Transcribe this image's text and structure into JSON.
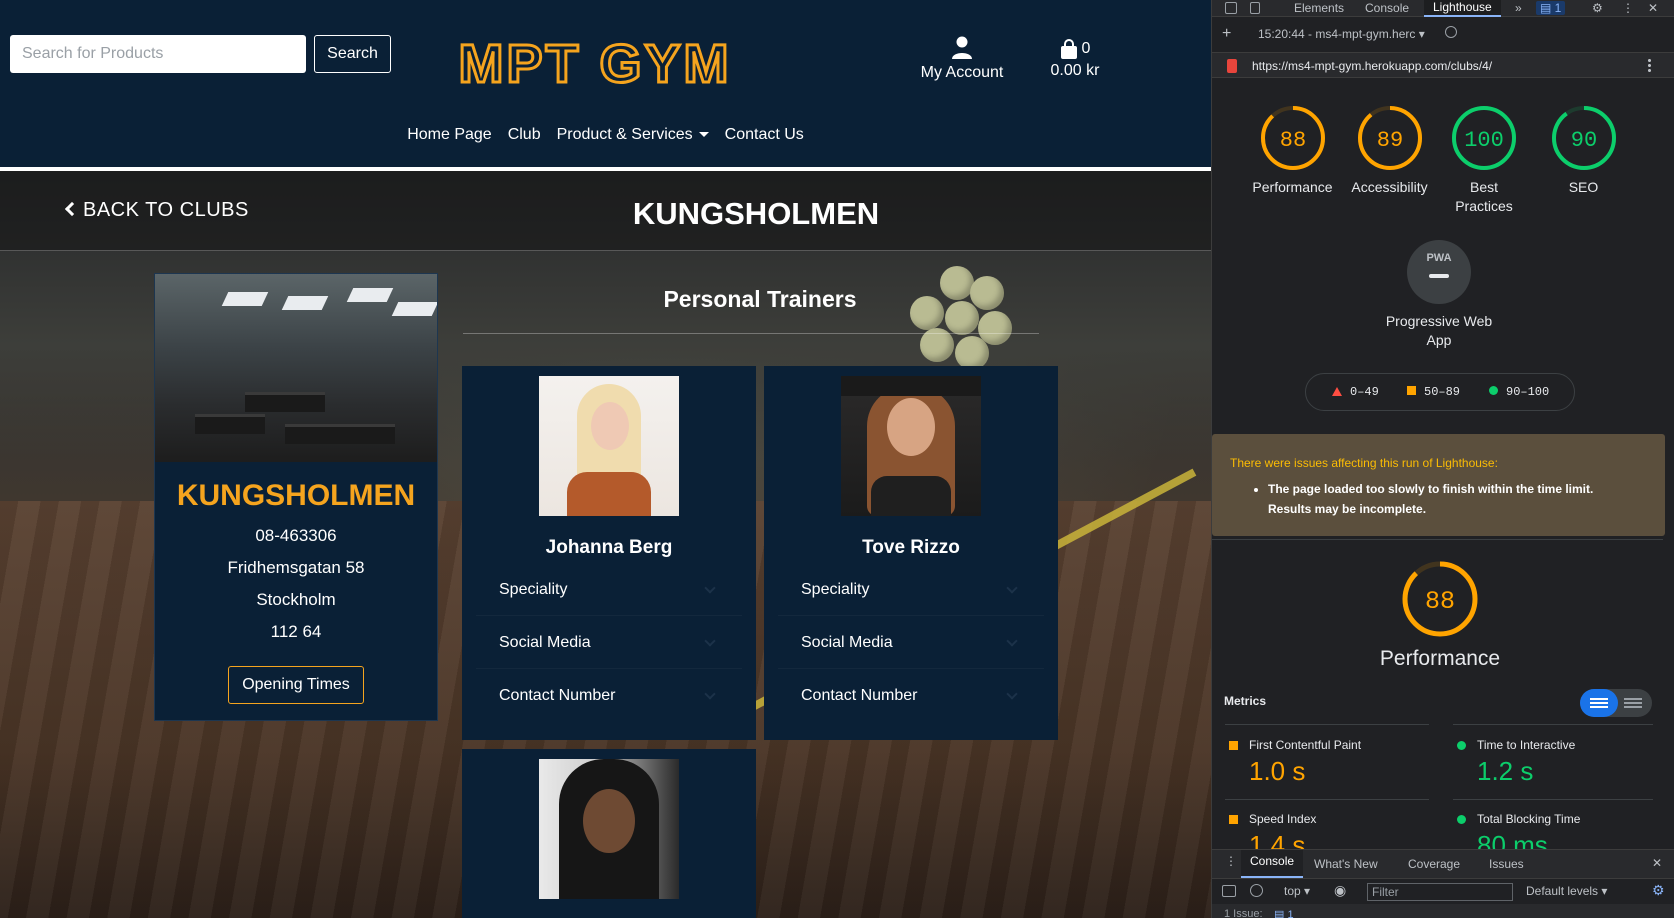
{
  "site": {
    "search": {
      "placeholder": "Search for Products",
      "button": "Search"
    },
    "logo_text": "MPT GYM",
    "account_label": "My Account",
    "cart": {
      "count": "0",
      "total": "0.00 kr"
    },
    "nav": [
      "Home Page",
      "Club",
      "Product & Services",
      "Contact Us"
    ],
    "back_label": "BACK TO CLUBS",
    "page_title": "KUNGSHOLMEN",
    "club": {
      "name": "KUNGSHOLMEN",
      "phone": "08-463306",
      "street": "Fridhemsgatan 58",
      "city": "Stockholm",
      "postcode": "112 64",
      "opening_button": "Opening Times"
    },
    "trainers_heading": "Personal Trainers",
    "trainers": [
      {
        "name": "Johanna Berg",
        "sections": [
          "Speciality",
          "Social Media",
          "Contact Number"
        ]
      },
      {
        "name": "Tove Rizzo",
        "sections": [
          "Speciality",
          "Social Media",
          "Contact Number"
        ]
      },
      {
        "name": "",
        "sections": []
      }
    ]
  },
  "devtools": {
    "tabs": [
      "Elements",
      "Console",
      "Lighthouse"
    ],
    "issues_badge": "1",
    "report_selector": "15:20:44 - ms4-mpt-gym.herc",
    "url": "https://ms4-mpt-gym.herokuapp.com/clubs/4/",
    "scores": [
      {
        "label": "Performance",
        "value": 88,
        "color": "#ffa400"
      },
      {
        "label": "Accessibility",
        "value": 89,
        "color": "#ffa400"
      },
      {
        "label": "Best Practices",
        "value": 100,
        "color": "#0cce6b"
      },
      {
        "label": "SEO",
        "value": 90,
        "color": "#0cce6b"
      }
    ],
    "pwa": {
      "badge": "PWA",
      "label": "Progressive Web App"
    },
    "legend": [
      "0–49",
      "50–89",
      "90–100"
    ],
    "warning": {
      "title": "There were issues affecting this run of Lighthouse:",
      "item": "The page loaded too slowly to finish within the time limit. Results may be incomplete."
    },
    "performance": {
      "value": 88,
      "label": "Performance",
      "color": "#ffa400"
    },
    "metrics_heading": "Metrics",
    "metrics": [
      {
        "label": "First Contentful Paint",
        "value": "1.0 s",
        "status": "average",
        "color": "#ffa400"
      },
      {
        "label": "Time to Interactive",
        "value": "1.2 s",
        "status": "pass",
        "color": "#0cce6b"
      },
      {
        "label": "Speed Index",
        "value": "1.4 s",
        "status": "average",
        "color": "#ffa400"
      },
      {
        "label": "Total Blocking Time",
        "value": "80 ms",
        "status": "pass",
        "color": "#0cce6b"
      }
    ],
    "drawer": {
      "tabs": [
        "Console",
        "What's New",
        "Coverage",
        "Issues"
      ],
      "context": "top",
      "filter_placeholder": "Filter",
      "levels": "Default levels",
      "issues_line": "1 Issue:",
      "issues_count": "1"
    }
  },
  "colors": {
    "navy": "#0a2036",
    "accent": "#f5a41e",
    "pass": "#0cce6b",
    "average": "#ffa400"
  }
}
